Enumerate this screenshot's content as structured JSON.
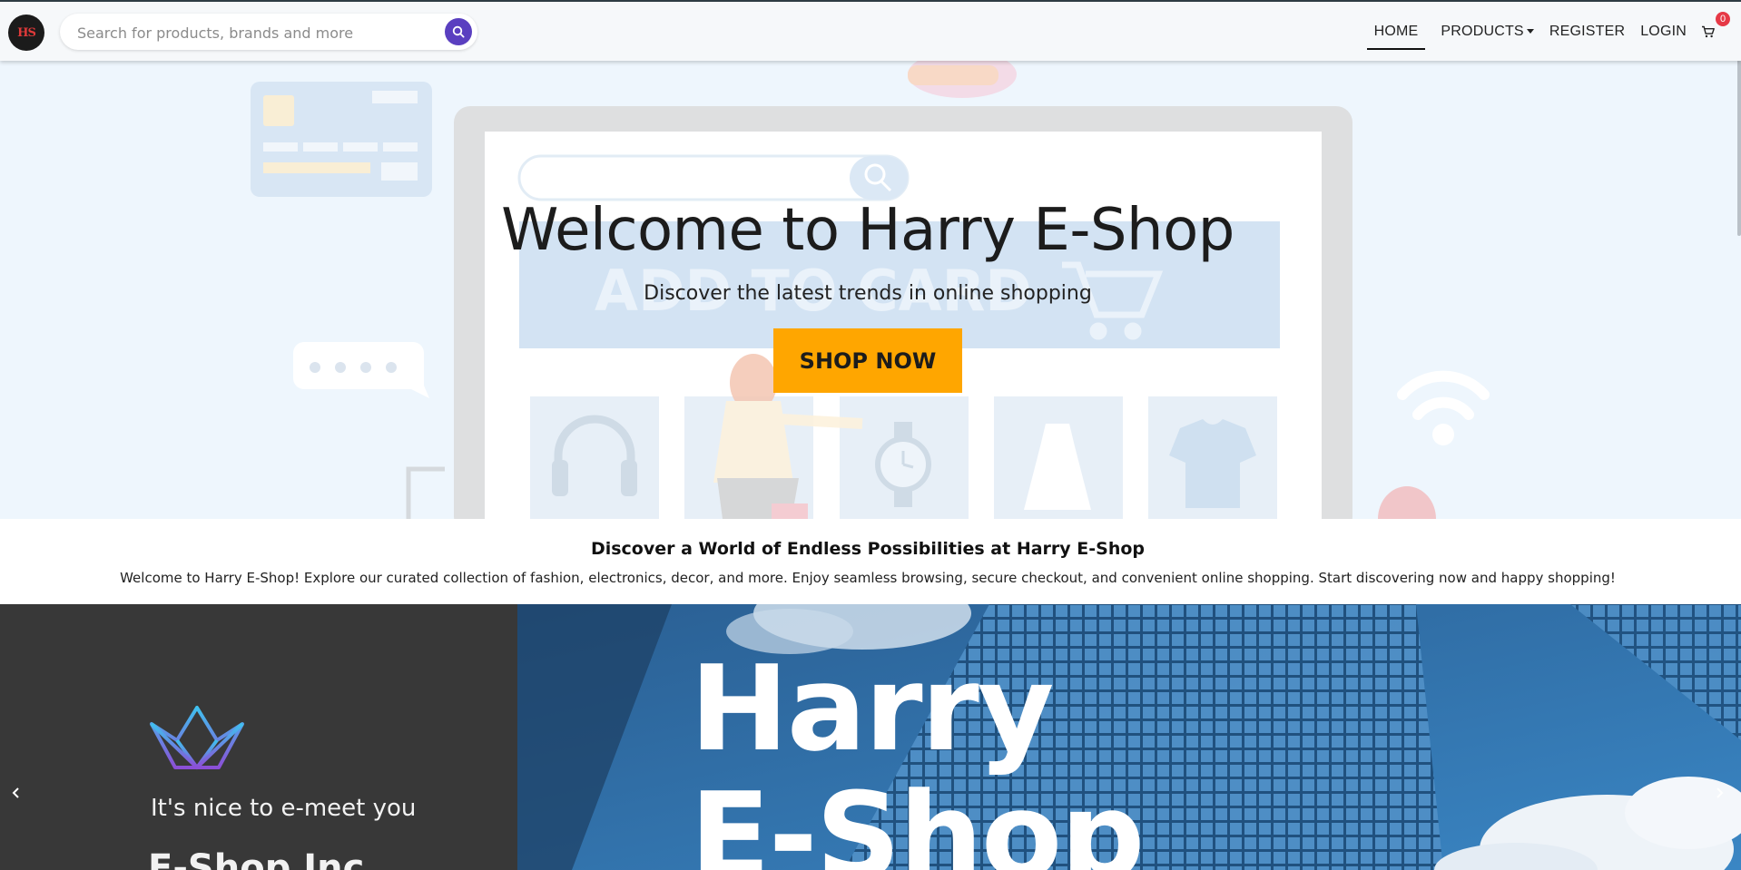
{
  "navbar": {
    "logo_text": "HS",
    "search_placeholder": "Search for products, brands and more",
    "links": [
      {
        "label": "HOME",
        "active": true
      },
      {
        "label": "PRODUCTS",
        "dropdown": true
      },
      {
        "label": "REGISTER"
      },
      {
        "label": "LOGIN"
      }
    ],
    "cart_count": "0",
    "icons": {
      "search": "search-icon",
      "cart": "cart-icon",
      "caret": "chevron-down-icon"
    }
  },
  "hero": {
    "title": "Welcome to Harry E-Shop",
    "subtitle": "Discover the latest trends in online shopping",
    "button_label": "SHOP NOW",
    "illustration_text": "ADD TO CARD",
    "colors": {
      "background": "#eef6fd",
      "button": "#ffa600"
    }
  },
  "info": {
    "title": "Discover a World of Endless Possibilities at Harry E-Shop",
    "text": "Welcome to Harry E-Shop! Explore our curated collection of fashion, electronics, decor, and more. Enjoy seamless browsing, secure checkout, and convenient online shopping. Start discovering now and happy shopping!"
  },
  "carousel": {
    "slide": {
      "tagline": "It's nice to e-meet you",
      "company": "E-Shop Inc.",
      "brand_line1": "Harry",
      "brand_line2": "E-Shop"
    },
    "prev_icon": "chevron-left-icon",
    "next_icon": "chevron-right-icon",
    "colors": {
      "left_panel": "#383838",
      "sky": "#2c6ea3"
    }
  }
}
